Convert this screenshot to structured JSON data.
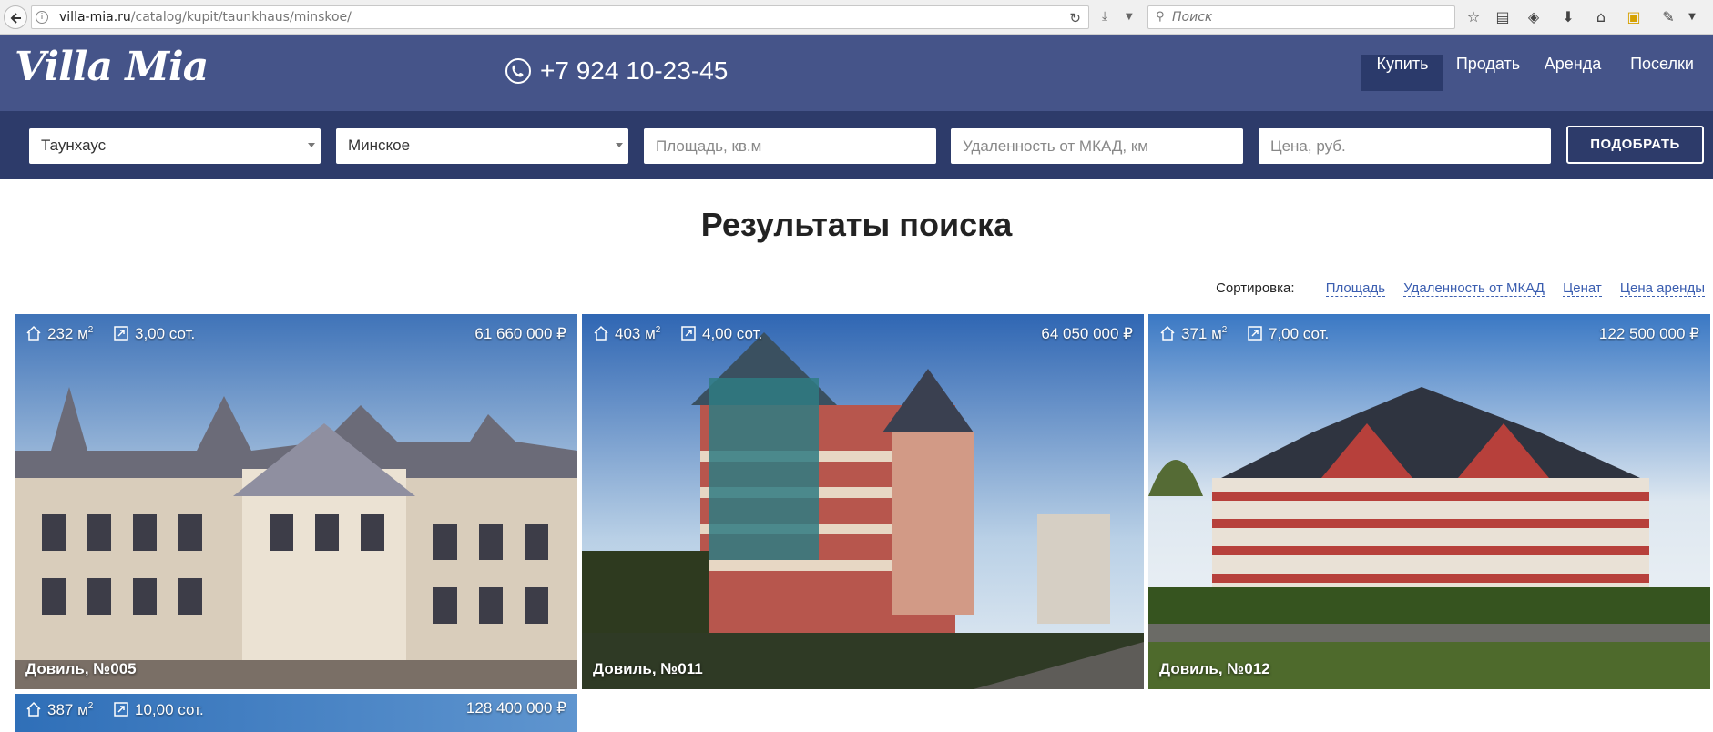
{
  "browser": {
    "url_host": "villa-mia.ru",
    "url_path": "/catalog/kupit/taunkhaus/minskoe/",
    "search_placeholder": "Поиск"
  },
  "header": {
    "logo": "Villa Mia",
    "phone": "+7 924 10-23-45",
    "nav": [
      {
        "label": "Купить",
        "active": true
      },
      {
        "label": "Продать",
        "active": false
      },
      {
        "label": "Аренда",
        "active": false
      },
      {
        "label": "Поселки",
        "active": false
      }
    ]
  },
  "filters": {
    "type_value": "Таунхаус",
    "direction_value": "Минское",
    "area_placeholder": "Площадь, кв.м",
    "distance_placeholder": "Удаленность от МКАД, км",
    "price_placeholder": "Цена, руб.",
    "submit_label": "ПОДОБРАТЬ"
  },
  "results": {
    "title": "Результаты поиска",
    "sort_label": "Сортировка:",
    "sort_options": [
      "Площадь",
      "Удаленность от МКАД",
      "Ценат",
      "Цена аренды"
    ]
  },
  "listings": [
    {
      "area": "232 м",
      "plot": "3,00 сот.",
      "price": "61 660 000 ₽",
      "name": "Довиль, №005"
    },
    {
      "area": "403 м",
      "plot": "4,00 сот.",
      "price": "64 050 000 ₽",
      "name": "Довиль, №011"
    },
    {
      "area": "371 м",
      "plot": "7,00 сот.",
      "price": "122 500 000 ₽",
      "name": "Довиль, №012"
    },
    {
      "area": "387 м",
      "plot": "10,00 сот.",
      "price": "128 400 000 ₽",
      "name": ""
    }
  ],
  "area_unit_sup": "2",
  "colors": {
    "header_bg": "#455489",
    "filter_bg": "#2d3b6a",
    "nav_active_bg": "#2b3a6b",
    "link": "#3b5eb0"
  },
  "icons": {
    "area": "house-icon",
    "plot": "plot-resize-icon",
    "phone": "phone-icon"
  }
}
